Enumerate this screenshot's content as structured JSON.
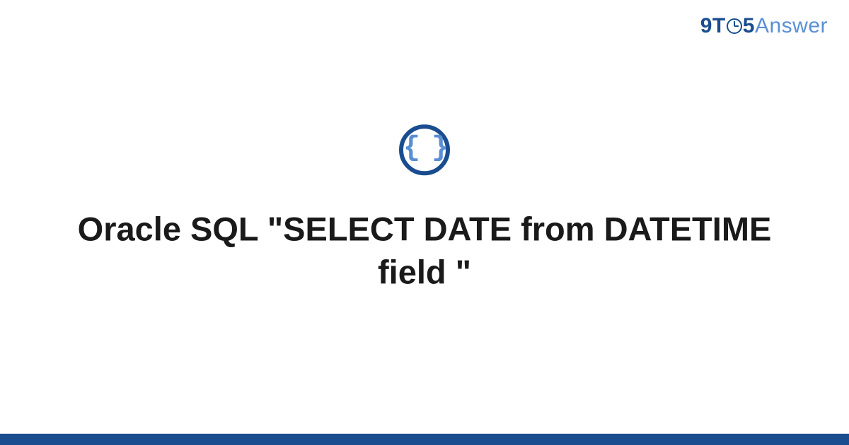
{
  "logo": {
    "prefix": "9T",
    "suffix": "5",
    "word": "Answer"
  },
  "icon": {
    "glyph": "{ }",
    "name": "code-braces-icon"
  },
  "title": "Oracle SQL \"SELECT DATE from DATETIME field \"",
  "colors": {
    "brand_dark": "#1a4d8f",
    "brand_light": "#5a8fd4"
  }
}
